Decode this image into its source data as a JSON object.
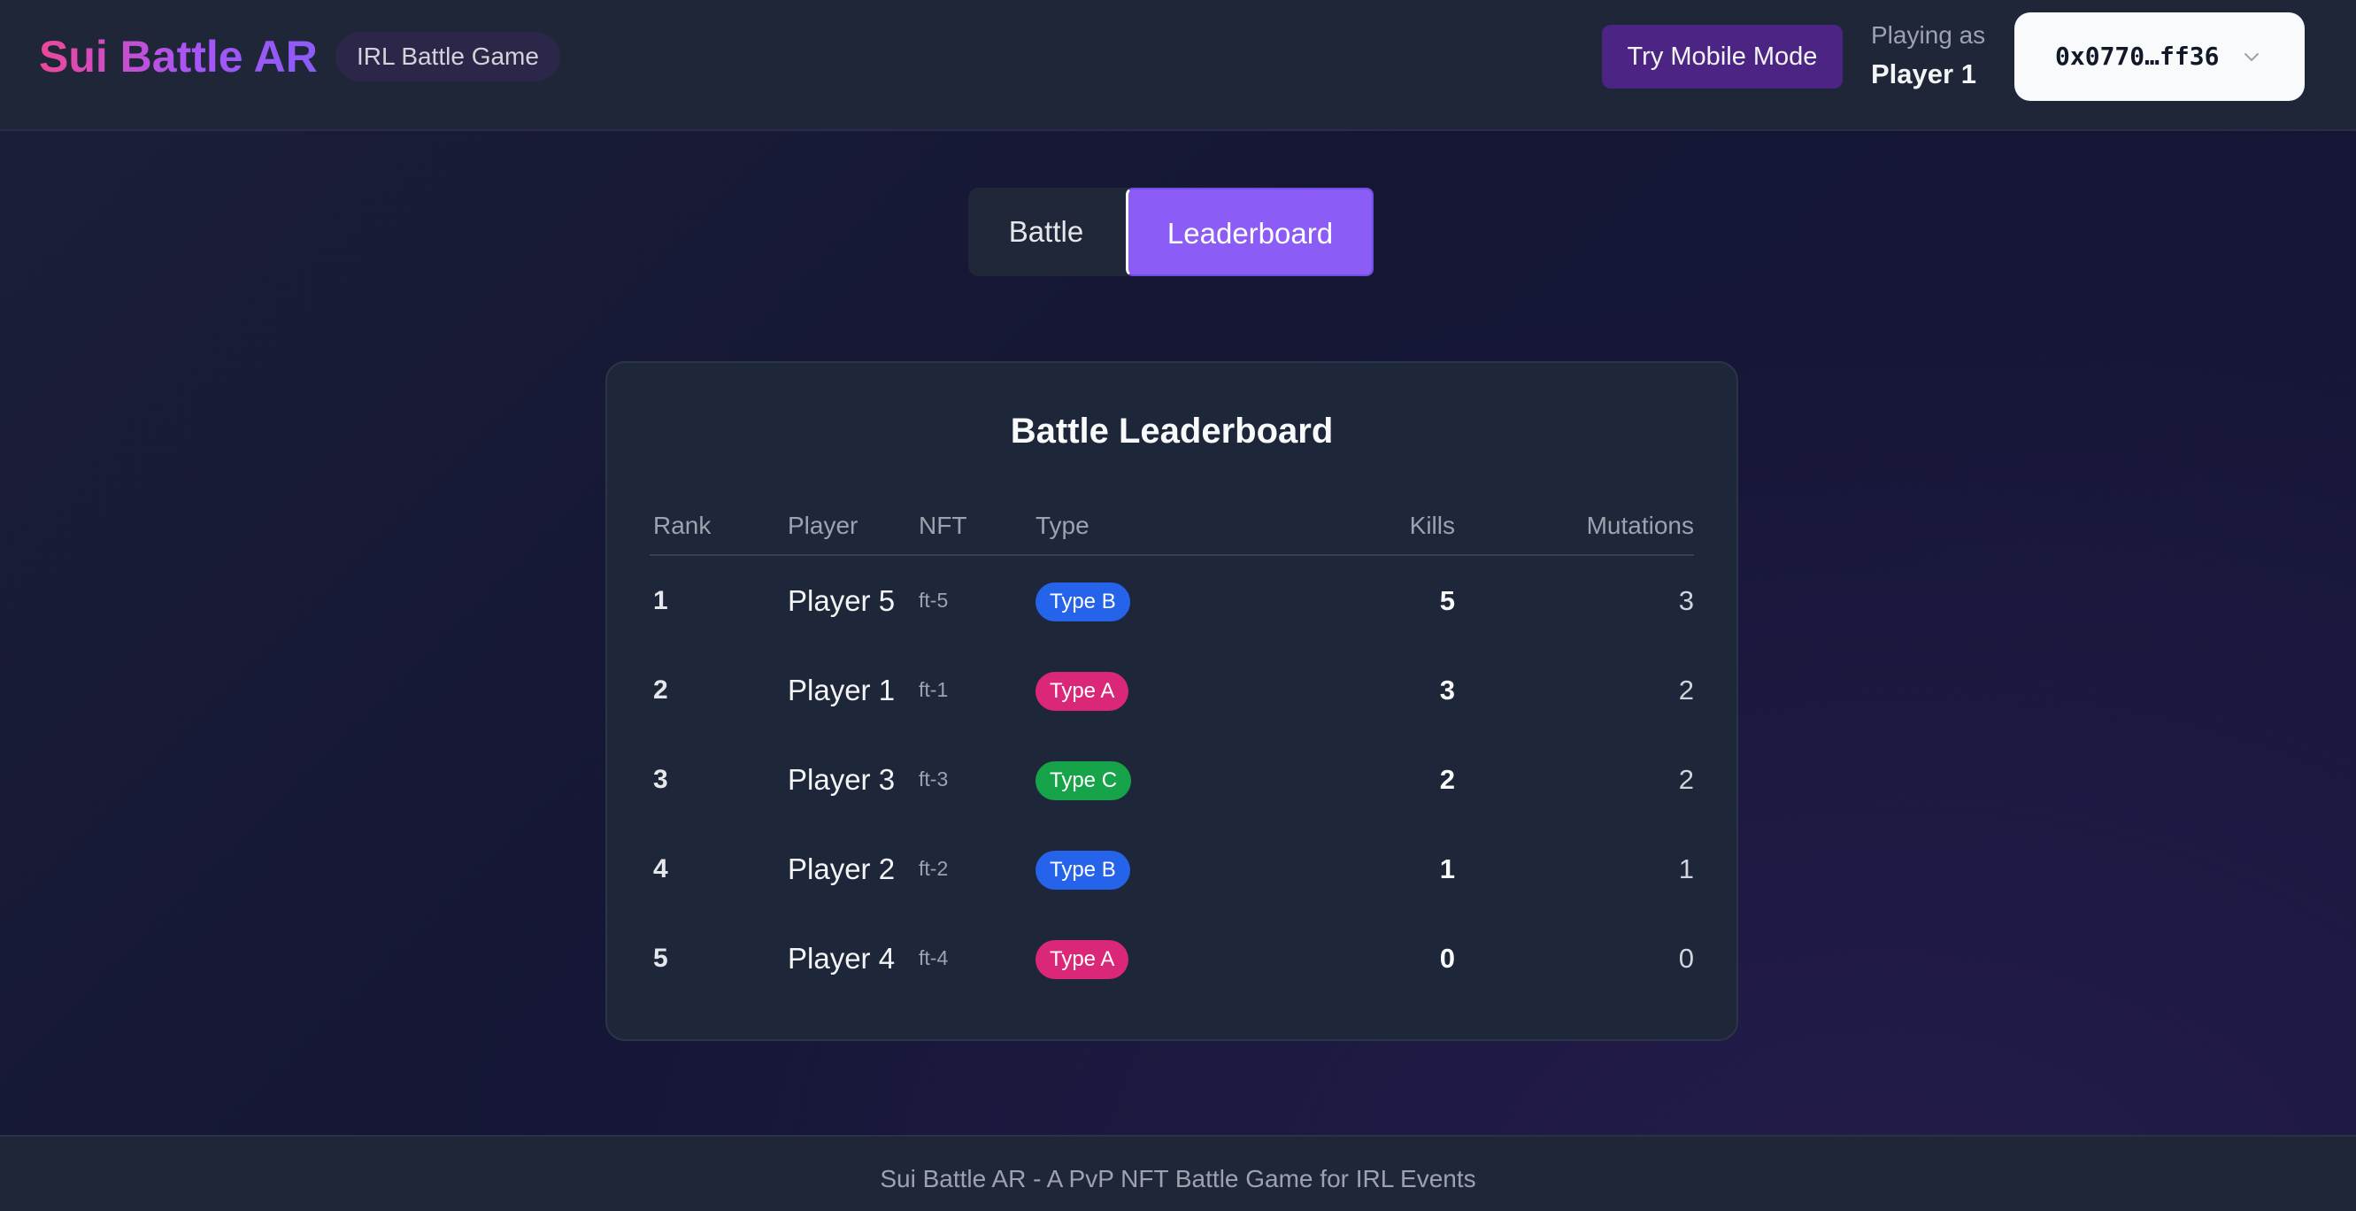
{
  "header": {
    "brand": "Sui Battle AR",
    "tag": "IRL Battle Game",
    "mobile_button": "Try Mobile Mode",
    "playing_as_label": "Playing as",
    "playing_as_name": "Player 1",
    "wallet_address": "0x0770…ff36",
    "wallet_chevron_icon": "chevron-down-icon"
  },
  "tabs": [
    {
      "label": "Battle",
      "active": false
    },
    {
      "label": "Leaderboard",
      "active": true
    }
  ],
  "leaderboard": {
    "title": "Battle Leaderboard",
    "columns": [
      "Rank",
      "Player",
      "NFT",
      "Type",
      "Kills",
      "Mutations"
    ],
    "rows": [
      {
        "rank": "1",
        "player": "Player 5",
        "nft": "ft-5",
        "type": "Type B",
        "kills": "5",
        "mutations": "3"
      },
      {
        "rank": "2",
        "player": "Player 1",
        "nft": "ft-1",
        "type": "Type A",
        "kills": "3",
        "mutations": "2"
      },
      {
        "rank": "3",
        "player": "Player 3",
        "nft": "ft-3",
        "type": "Type C",
        "kills": "2",
        "mutations": "2"
      },
      {
        "rank": "4",
        "player": "Player 2",
        "nft": "ft-2",
        "type": "Type B",
        "kills": "1",
        "mutations": "1"
      },
      {
        "rank": "5",
        "player": "Player 4",
        "nft": "ft-4",
        "type": "Type A",
        "kills": "0",
        "mutations": "0"
      }
    ]
  },
  "type_colors": {
    "Type A": "#db2777",
    "Type B": "#2563eb",
    "Type C": "#16a34a"
  },
  "footer": {
    "text": "Sui Battle AR - A PvP NFT Battle Game for IRL Events"
  }
}
